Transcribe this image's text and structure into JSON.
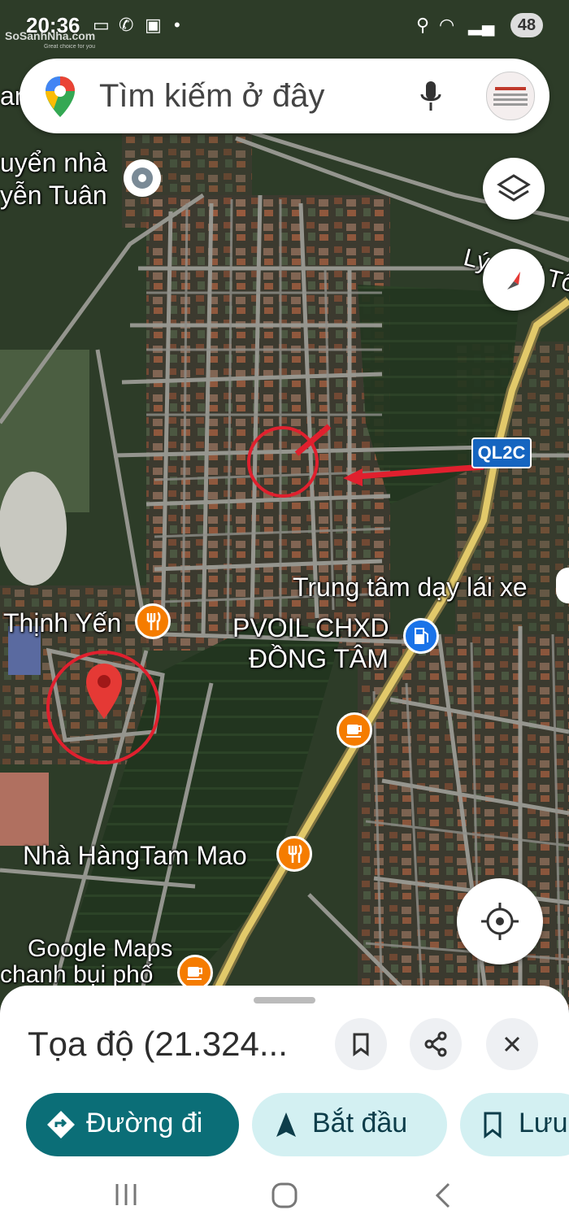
{
  "status_bar": {
    "time": "20:36",
    "battery": "48"
  },
  "watermark": {
    "text": "SoSanhNha.com",
    "tagline": "Great choice for you"
  },
  "search": {
    "placeholder": "Tìm kiếm ở đây"
  },
  "map": {
    "labels": {
      "place_top_left_1": "uyển nhà",
      "place_top_left_2": "yễn Tuân",
      "road_ly_thai_to": "Lý Thái Tổ",
      "route_badge": "QL2C",
      "driving_school": "Trung tâm dạy lái xe",
      "restaurant_thinh_yen": "Thịnh Yến",
      "gas_station_1": "PVOIL CHXD",
      "gas_station_2": "ĐỒNG TÂM",
      "restaurant_tam_mao": "Nhà HàngTam Mao",
      "cafe_bottom": "chanh bụi phố",
      "google_maps": "Google Maps",
      "edge_left": "an"
    },
    "colors": {
      "pin": "#e53935",
      "annotation": "#e0202e",
      "restaurant_poi": "#f57c00",
      "gas_poi": "#1a73e8",
      "route_badge_bg": "#1565c0"
    }
  },
  "sheet": {
    "title": "Tọa độ (21.324...",
    "actions": {
      "directions": "Đường đi",
      "start": "Bắt đầu",
      "save": "Lưu"
    }
  }
}
